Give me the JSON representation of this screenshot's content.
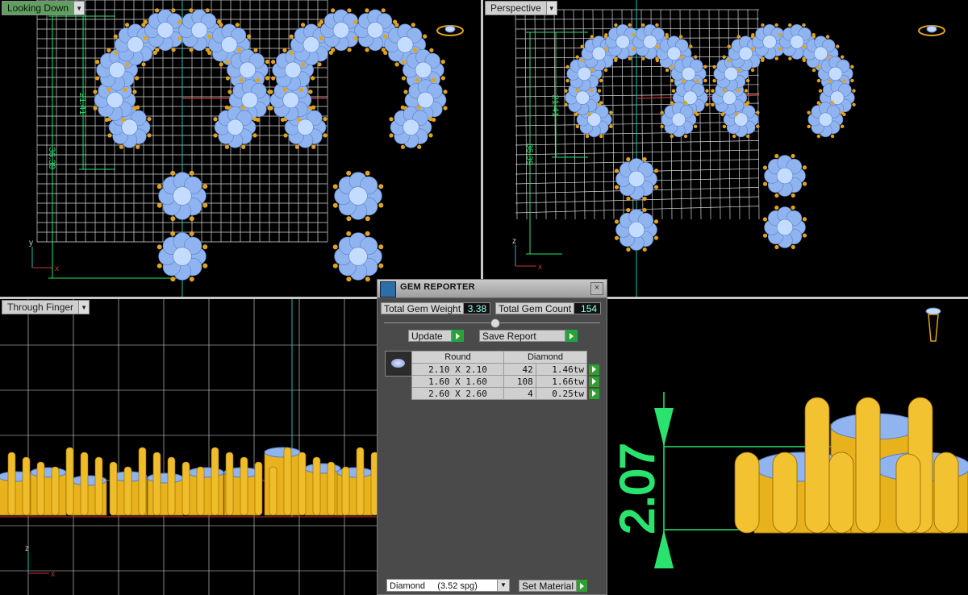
{
  "viewports": {
    "top_left": {
      "label": "Looking Down",
      "dim_a": "21.41",
      "dim_b": "36.39",
      "axis_v": "y",
      "axis_h": "x"
    },
    "top_right": {
      "label": "Perspective",
      "dim_a": "21.41",
      "dim_b": "36.39",
      "axis_v": "z",
      "axis_h": "x"
    },
    "bottom_left": {
      "label": "Through Finger",
      "axis_v": "z",
      "axis_h": "x"
    },
    "bottom_right": {
      "dimension": "2.07"
    }
  },
  "gem_reporter": {
    "title": "GEM REPORTER",
    "close": "×",
    "total_weight_label": "Total Gem Weight",
    "total_weight_value": "3.38",
    "total_count_label": "Total Gem Count",
    "total_count_value": "154",
    "update_label": "Update",
    "save_report_label": "Save Report",
    "table": {
      "col_shape": "Round",
      "col_material": "Diamond",
      "rows": [
        {
          "size": "2.10 X 2.10",
          "count": "42",
          "weight": "1.46tw"
        },
        {
          "size": "1.60 X 1.60",
          "count": "108",
          "weight": "1.66tw"
        },
        {
          "size": "2.60 X 2.60",
          "count": "4",
          "weight": "0.25tw"
        }
      ]
    },
    "material_select": "Diamond     (3.52 spg)",
    "set_material_label": "Set Material"
  },
  "colors": {
    "grid": "#e8e8e8",
    "gem": "#8fb4f0",
    "prong": "#e2a21a",
    "dim_green": "#2ae36e"
  }
}
